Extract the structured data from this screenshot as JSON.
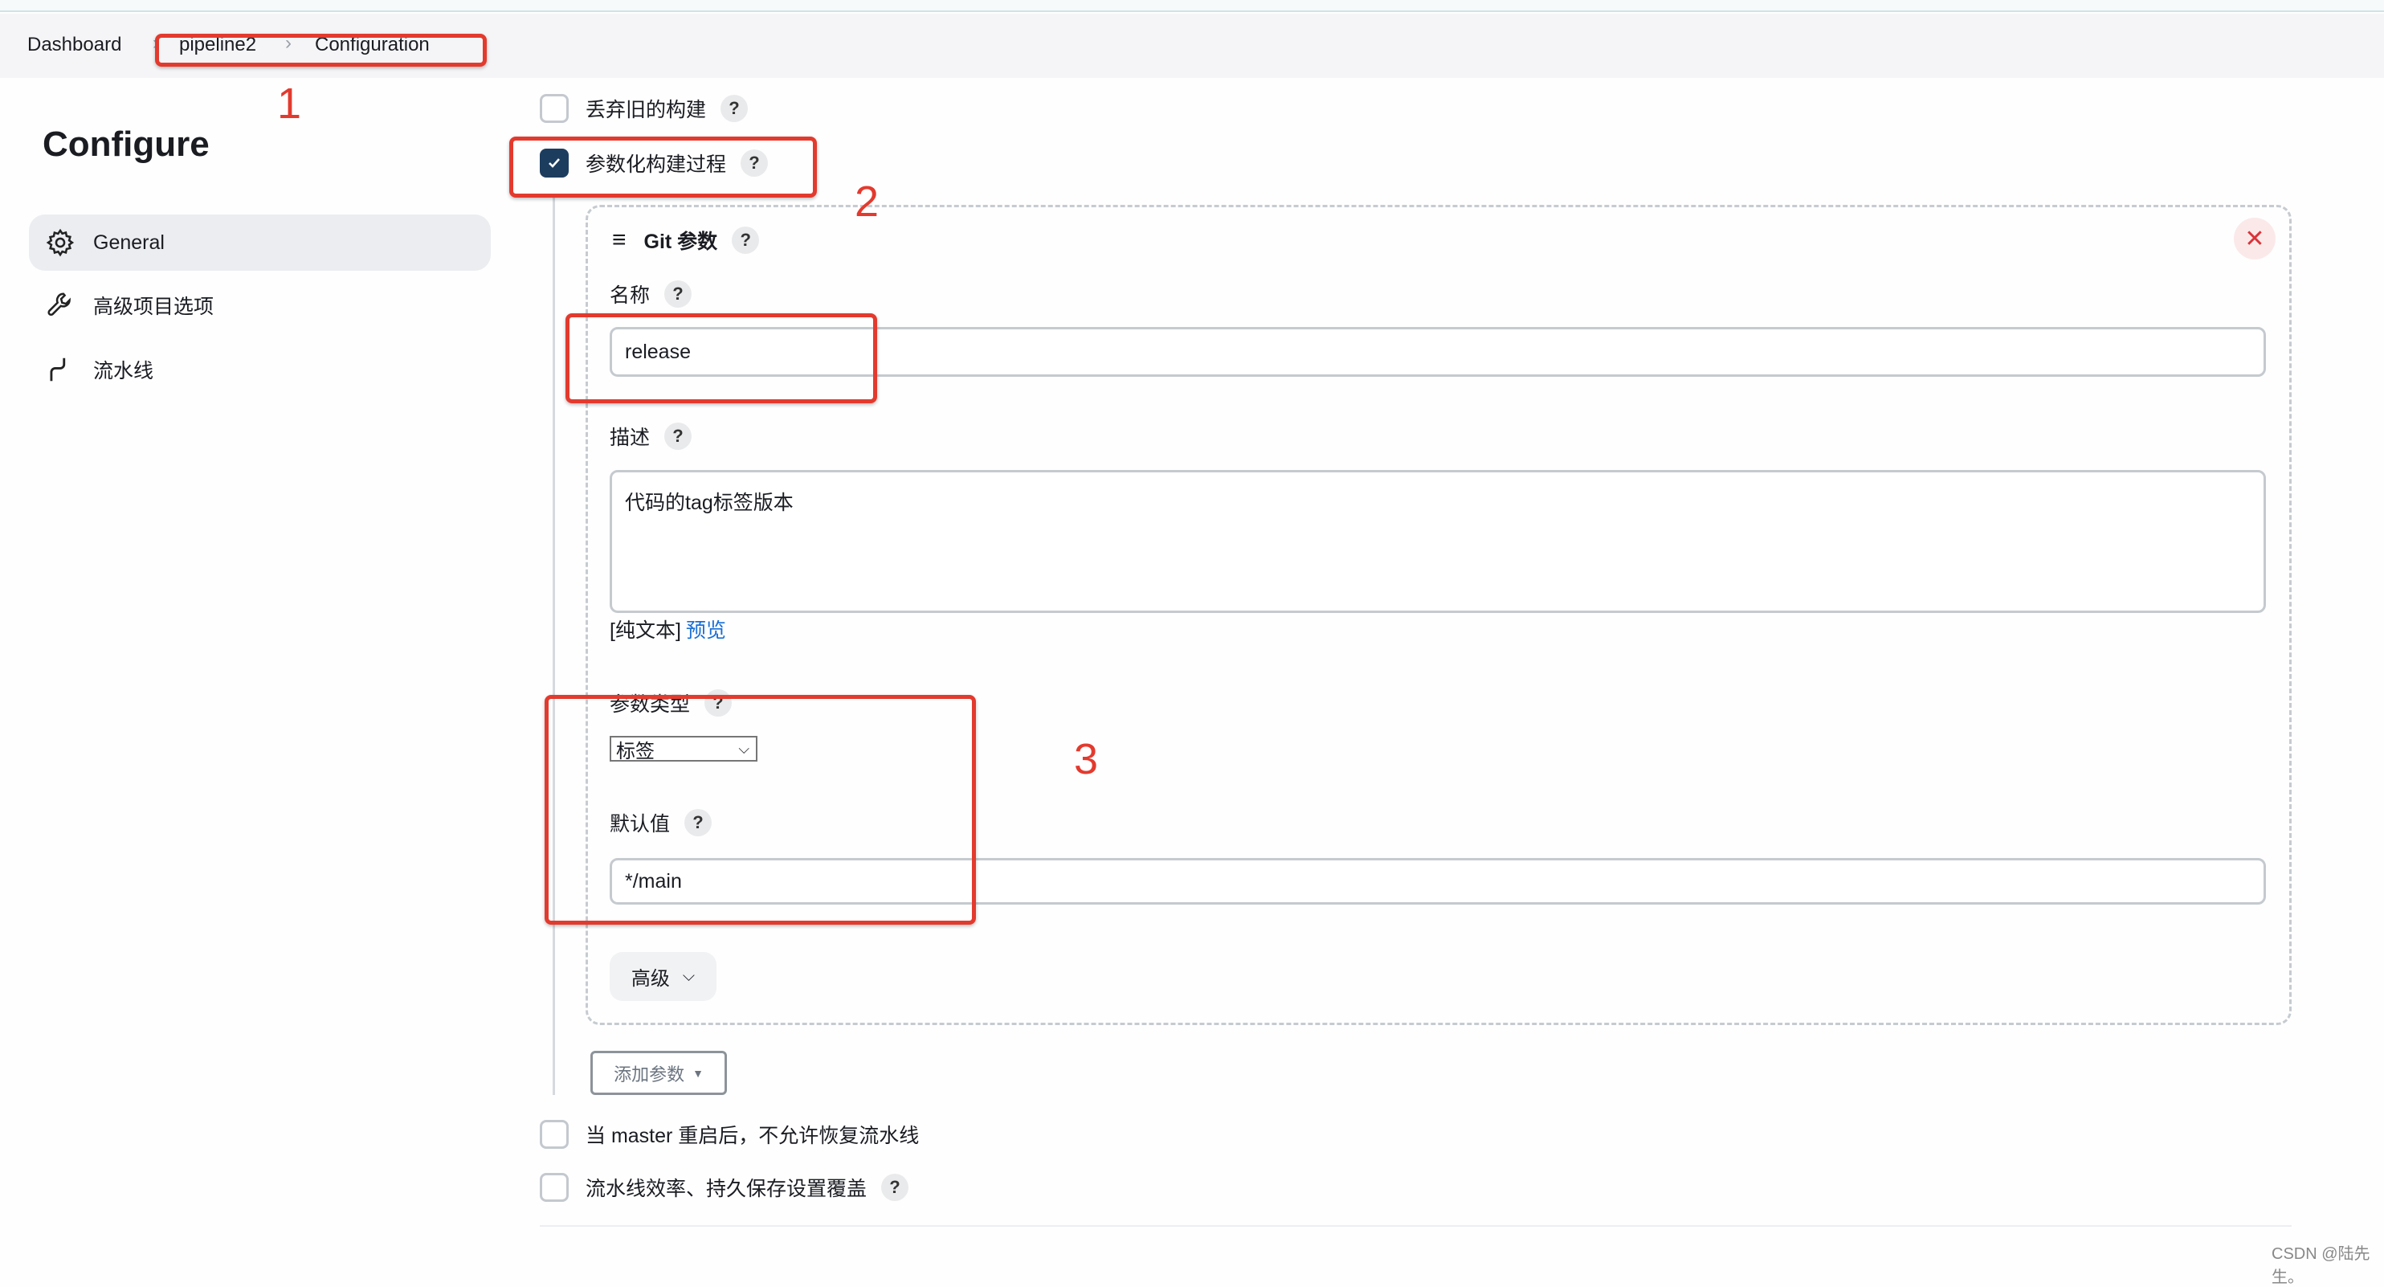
{
  "breadcrumb": [
    "Dashboard",
    "pipeline2",
    "Configuration"
  ],
  "page_title": "Configure",
  "sidebar": {
    "items": [
      {
        "label": "General",
        "icon": "gear-icon",
        "active": true
      },
      {
        "label": "高级项目选项",
        "icon": "wrench-icon"
      },
      {
        "label": "流水线",
        "icon": "pipeline-icon"
      }
    ]
  },
  "options": {
    "discard_old": {
      "label": "丢弃旧的构建",
      "checked": false
    },
    "parameterized": {
      "label": "参数化构建过程",
      "checked": true
    },
    "no_resume": {
      "label": "当 master 重启后，不允许恢复流水线",
      "checked": false
    },
    "durability": {
      "label": "流水线效率、持久保存设置覆盖",
      "checked": false
    }
  },
  "param": {
    "title": "Git 参数",
    "name_label": "名称",
    "name_value": "release",
    "desc_label": "描述",
    "desc_value": "代码的tag标签版本",
    "format_plain": "[纯文本]",
    "format_preview": "预览",
    "type_label": "参数类型",
    "type_value": "标签",
    "default_label": "默认值",
    "default_value": "*/main",
    "advanced_label": "高级"
  },
  "add_param_label": "添加参数",
  "help": "?",
  "annotations": [
    "1",
    "2",
    "3"
  ],
  "watermark": "CSDN @陆先生。",
  "colors": {
    "annotation": "#e33a2e",
    "checkbox_checked": "#1d3d5e",
    "link": "#1a6fd6",
    "close": "#d8343a"
  }
}
